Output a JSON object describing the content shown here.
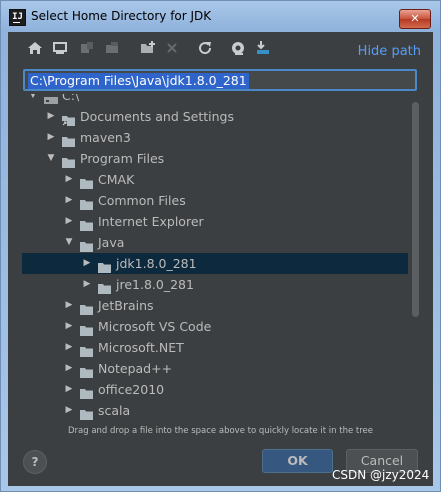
{
  "window": {
    "title": "Select Home Directory for JDK",
    "close_glyph": "✕"
  },
  "toolbar": {
    "hide_path_label": "Hide path",
    "icons": [
      "home-icon",
      "desktop-icon",
      "project-icon",
      "module-icon",
      "new-folder-icon",
      "delete-icon",
      "refresh-icon",
      "show-hidden-icon",
      "select-file-icon"
    ]
  },
  "path": {
    "value": "C:\\Program Files\\Java\\jdk1.8.0_281"
  },
  "tree": {
    "rows": [
      {
        "label": "C:\\",
        "level": 0,
        "state": "expanded",
        "icon": "drive"
      },
      {
        "label": "Documents and Settings",
        "level": 1,
        "state": "collapsed",
        "icon": "folder-link"
      },
      {
        "label": "maven3",
        "level": 1,
        "state": "collapsed",
        "icon": "folder"
      },
      {
        "label": "Program Files",
        "level": 1,
        "state": "expanded",
        "icon": "folder"
      },
      {
        "label": "CMAK",
        "level": 2,
        "state": "collapsed",
        "icon": "folder"
      },
      {
        "label": "Common Files",
        "level": 2,
        "state": "collapsed",
        "icon": "folder"
      },
      {
        "label": "Internet Explorer",
        "level": 2,
        "state": "collapsed",
        "icon": "folder"
      },
      {
        "label": "Java",
        "level": 2,
        "state": "expanded",
        "icon": "folder"
      },
      {
        "label": "jdk1.8.0_281",
        "level": 3,
        "state": "collapsed",
        "icon": "folder",
        "selected": true
      },
      {
        "label": "jre1.8.0_281",
        "level": 3,
        "state": "collapsed",
        "icon": "folder"
      },
      {
        "label": "JetBrains",
        "level": 2,
        "state": "collapsed",
        "icon": "folder"
      },
      {
        "label": "Microsoft VS Code",
        "level": 2,
        "state": "collapsed",
        "icon": "folder"
      },
      {
        "label": "Microsoft.NET",
        "level": 2,
        "state": "collapsed",
        "icon": "folder"
      },
      {
        "label": "Notepad++",
        "level": 2,
        "state": "collapsed",
        "icon": "folder"
      },
      {
        "label": "office2010",
        "level": 2,
        "state": "collapsed",
        "icon": "folder"
      },
      {
        "label": "scala",
        "level": 2,
        "state": "collapsed",
        "icon": "folder"
      }
    ]
  },
  "hint": "Drag and drop a file into the space above to quickly locate it in the tree",
  "buttons": {
    "help": "?",
    "ok": "OK",
    "cancel": "Cancel"
  },
  "watermark": "CSDN @jzy2024",
  "colors": {
    "background": "#3c3f41",
    "selection": "#0d293e",
    "link": "#589df6",
    "ok_button": "#365880",
    "path_highlight": "#2f65ca"
  }
}
